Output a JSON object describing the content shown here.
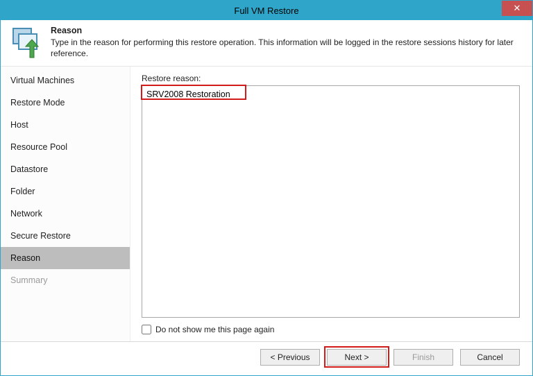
{
  "window": {
    "title": "Full VM Restore"
  },
  "header": {
    "title": "Reason",
    "description": "Type in the reason for performing this restore operation. This information will be logged in the restore sessions history for later reference."
  },
  "sidebar": {
    "items": [
      {
        "label": "Virtual Machines",
        "active": false
      },
      {
        "label": "Restore Mode",
        "active": false
      },
      {
        "label": "Host",
        "active": false
      },
      {
        "label": "Resource Pool",
        "active": false
      },
      {
        "label": "Datastore",
        "active": false
      },
      {
        "label": "Folder",
        "active": false
      },
      {
        "label": "Network",
        "active": false
      },
      {
        "label": "Secure Restore",
        "active": false
      },
      {
        "label": "Reason",
        "active": true
      },
      {
        "label": "Summary",
        "active": false,
        "disabled": true
      }
    ]
  },
  "main": {
    "reason_label": "Restore reason:",
    "reason_value": "SRV2008 Restoration",
    "checkbox_label": "Do not show me this page again",
    "checkbox_checked": false
  },
  "footer": {
    "previous": "< Previous",
    "next": "Next >",
    "finish": "Finish",
    "cancel": "Cancel"
  }
}
